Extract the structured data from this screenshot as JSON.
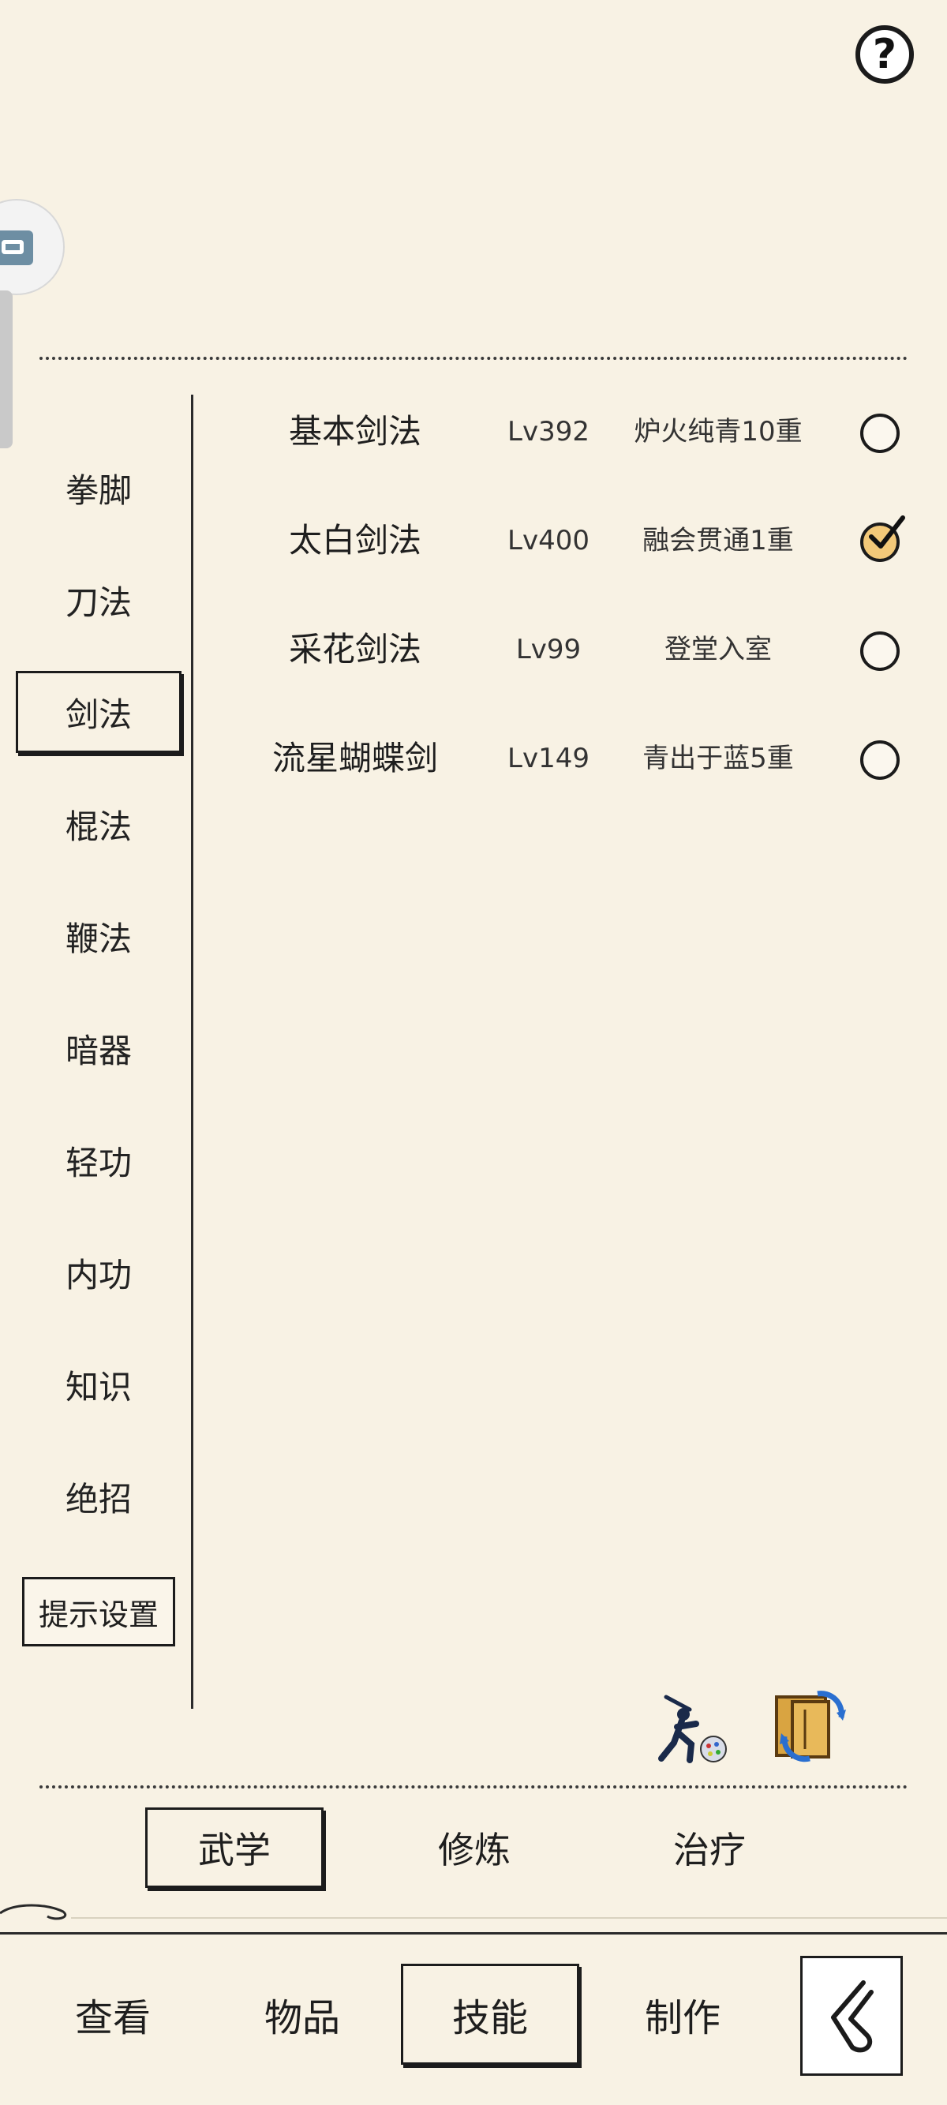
{
  "help": {
    "label": "?"
  },
  "sidebar": {
    "items": [
      {
        "label": "拳脚"
      },
      {
        "label": "刀法"
      },
      {
        "label": "剑法"
      },
      {
        "label": "棍法"
      },
      {
        "label": "鞭法"
      },
      {
        "label": "暗器"
      },
      {
        "label": "轻功"
      },
      {
        "label": "内功"
      },
      {
        "label": "知识"
      },
      {
        "label": "绝招"
      }
    ],
    "active_index": 2,
    "settings_label": "提示设置"
  },
  "skills": [
    {
      "name": "基本剑法",
      "level": "Lv392",
      "realm": "炉火纯青10重",
      "checked": false
    },
    {
      "name": "太白剑法",
      "level": "Lv400",
      "realm": "融会贯通1重",
      "checked": true
    },
    {
      "name": "采花剑法",
      "level": "Lv99",
      "realm": "登堂入室",
      "checked": false
    },
    {
      "name": "流星蝴蝶剑",
      "level": "Lv149",
      "realm": "青出于蓝5重",
      "checked": false
    }
  ],
  "subtabs": [
    {
      "label": "武学"
    },
    {
      "label": "修炼"
    },
    {
      "label": "治疗"
    }
  ],
  "bottom_nav": [
    {
      "label": "查看"
    },
    {
      "label": "物品"
    },
    {
      "label": "技能"
    },
    {
      "label": "制作"
    }
  ],
  "icons": {
    "help": "question-icon",
    "skill_action_1": "swordsman-icon",
    "skill_action_2": "scroll-swap-icon",
    "back": "back-arrow-icon"
  },
  "colors": {
    "background": "#f8f2e4",
    "ink": "#1e1e1e",
    "check_fill": "#f3c979"
  }
}
